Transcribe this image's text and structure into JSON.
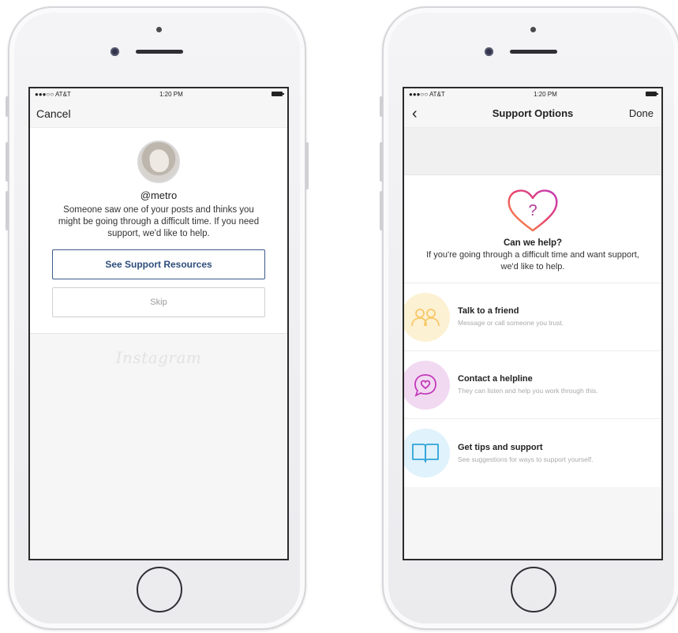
{
  "left_phone": {
    "status": {
      "carrier": "●●●○○ AT&T",
      "time": "1:20 PM"
    },
    "nav": {
      "cancel_label": "Cancel"
    },
    "card": {
      "username": "@metro",
      "message": "Someone saw one of your posts and thinks you might be going through a difficult time. If you need support, we'd like to help.",
      "primary_button": "See Support Resources",
      "skip_button": "Skip"
    },
    "footer_logo": "Instagram"
  },
  "right_phone": {
    "status": {
      "carrier": "●●●○○ AT&T",
      "time": "1:20 PM"
    },
    "nav": {
      "back_label": "‹",
      "title": "Support Options",
      "done_label": "Done"
    },
    "help": {
      "icon_glyph": "?",
      "title": "Can we help?",
      "subtitle": "If you're going through a difficult time and want support, we'd like to help."
    },
    "options": [
      {
        "title": "Talk to a friend",
        "description": "Message or call someone you trust.",
        "icon": "friends-icon",
        "color": "#f7c868"
      },
      {
        "title": "Contact a helpline",
        "description": "They can listen and help you work through this.",
        "icon": "helpline-chat-icon",
        "color": "#c13ab9"
      },
      {
        "title": "Get tips and support",
        "description": "See suggestions for ways to support yourself.",
        "icon": "book-icon",
        "color": "#2fa5d9"
      }
    ]
  },
  "colors": {
    "primary_button_text": "#2e4d7b",
    "heart_gradient_start": "#f9a03f",
    "heart_gradient_end": "#c13ab9"
  }
}
